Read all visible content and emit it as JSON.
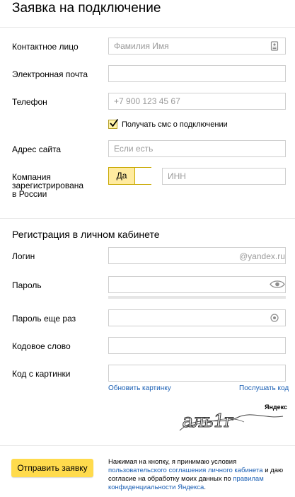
{
  "title": "Заявка на подключение",
  "contact": {
    "label": "Контактное лицо",
    "placeholder": "Фамилия Имя"
  },
  "email": {
    "label": "Электронная почта",
    "value": ""
  },
  "phone": {
    "label": "Телефон",
    "placeholder": "+7 900 123 45 67",
    "sms_label": "Получать смс о подключении",
    "sms_checked": true
  },
  "site": {
    "label": "Адрес сайта",
    "placeholder": "Если есть"
  },
  "company": {
    "label_line1": "Компания",
    "label_line2": "зарегистрирована",
    "label_line3": "в России",
    "toggle_label": "Да",
    "inn_placeholder": "ИНН"
  },
  "registration": {
    "title": "Регистрация в личном кабинете",
    "login_label": "Логин",
    "login_suffix": "@yandex.ru",
    "password_label": "Пароль",
    "password_repeat_label": "Пароль еще раз",
    "codeword_label": "Кодовое слово",
    "captcha_label": "Код с картинки",
    "refresh_link": "Обновить картинку",
    "listen_link": "Послушать код",
    "captcha_brand": "Яндекс",
    "captcha_text": "аль1г"
  },
  "footer": {
    "submit_label": "Отправить заявку",
    "agree_text_1": "Нажимая на кнопку, я принимаю условия",
    "agree_link_1": "пользовательского соглашения личного кабинета",
    "agree_text_2": "и даю согласие на обработку моих данных по",
    "agree_link_2": "правилам конфиденциальности Яндекса",
    "agree_text_3": "."
  },
  "colors": {
    "accent": "#ffdb4d",
    "link": "#1a5fb4",
    "border": "#cfcfcf"
  }
}
